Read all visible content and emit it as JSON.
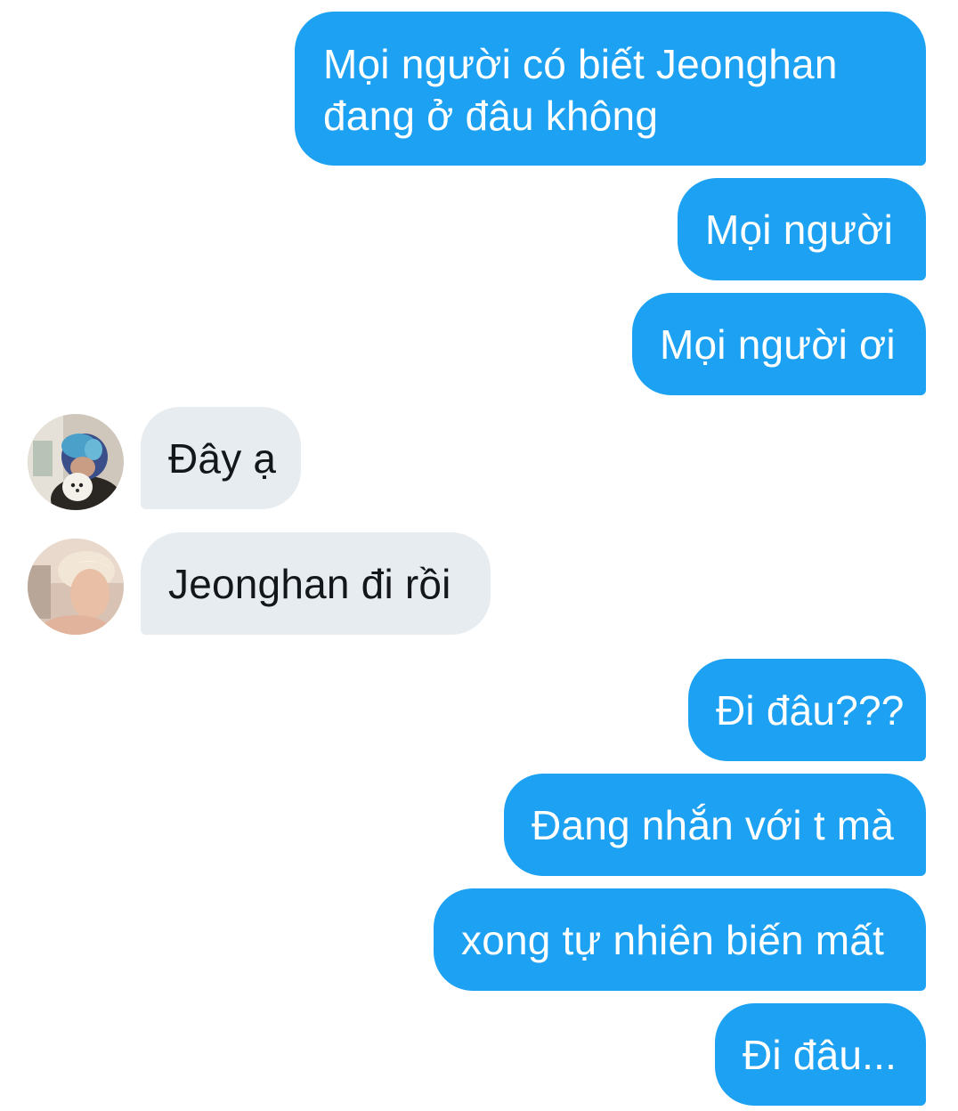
{
  "chat": {
    "messages": [
      {
        "from": "me",
        "text": "Mọi người có biết Jeonghan\nđang ở đâu không"
      },
      {
        "from": "me",
        "text": "Mọi người"
      },
      {
        "from": "me",
        "text": "Mọi người ơi"
      },
      {
        "from": "user-1",
        "avatar": "user-avatar-blue-hair-with-dog",
        "text": "Đây ạ"
      },
      {
        "from": "user-2",
        "avatar": "user-avatar-blond-profile",
        "text": "Jeonghan đi rồi"
      },
      {
        "from": "me",
        "text": "Đi đâu???"
      },
      {
        "from": "me",
        "text": "Đang nhắn với t mà"
      },
      {
        "from": "me",
        "text": "xong tự nhiên biến mất"
      },
      {
        "from": "me",
        "text": "Đi đâu..."
      }
    ]
  },
  "colors": {
    "outgoing_bubble": "#1da1f2",
    "incoming_bubble": "#e6ecf0",
    "outgoing_text": "#ffffff",
    "incoming_text": "#14171a"
  }
}
